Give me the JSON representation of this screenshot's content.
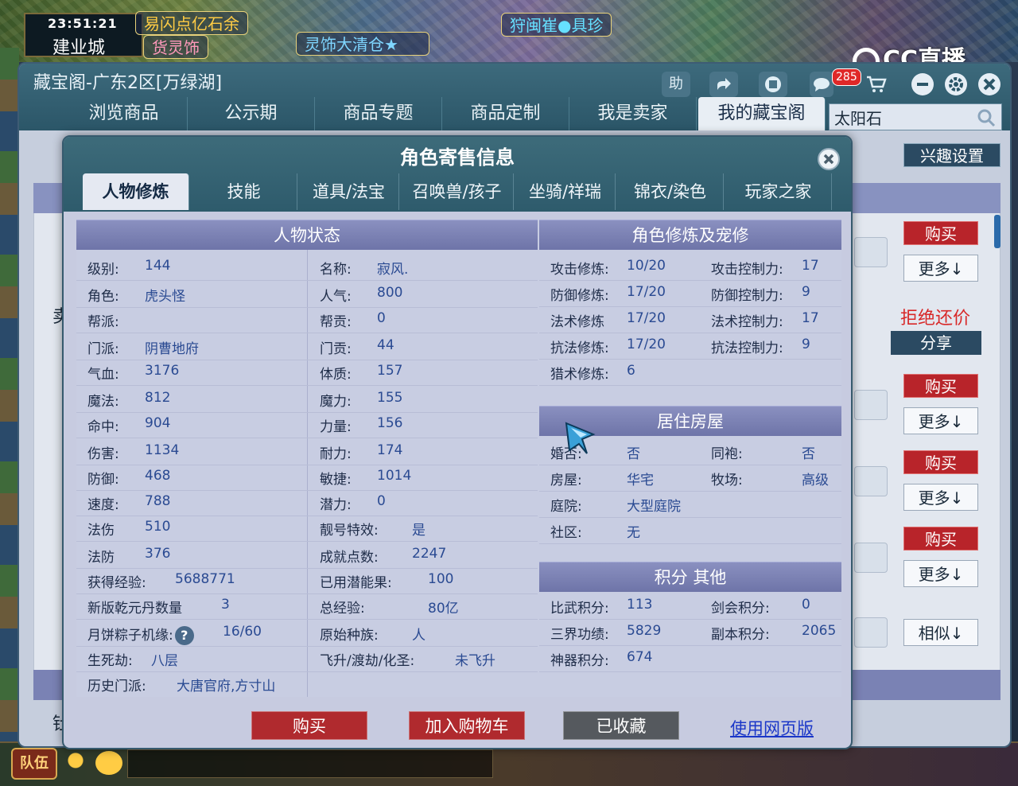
{
  "game": {
    "time": "23:51:21",
    "city": "建业城",
    "banners": [
      "易闪点亿石余",
      "货灵饰",
      "灵饰大清仓★",
      "狩闽崔●具珍"
    ],
    "stream_logo": "CC直播"
  },
  "window": {
    "title": "藏宝阁-广东2区[万绿湖]",
    "help_label": "助",
    "notif_count": "285",
    "nav_tabs": [
      "浏览商品",
      "公示期",
      "商品专题",
      "商品定制",
      "我是卖家",
      "我的藏宝阁"
    ],
    "search_value": "太阳石",
    "interest_label": "兴趣设置",
    "reject_text": "拒绝还价",
    "share_label": "分享",
    "side_buy": "购买",
    "side_more": "更多↓",
    "side_similar": "相似↓",
    "bg_label_1": "卖",
    "bg_label_2": "钍"
  },
  "dialog": {
    "title": "角色寄售信息",
    "tabs": [
      "人物修炼",
      "技能",
      "道具/法宝",
      "召唤兽/孩子",
      "坐骑/祥瑞",
      "锦衣/染色",
      "玩家之家"
    ],
    "status": {
      "header": "人物状态",
      "left": [
        {
          "label": "级别:",
          "value": "144"
        },
        {
          "label": "角色:",
          "value": "虎头怪"
        },
        {
          "label": "帮派:",
          "value": ""
        },
        {
          "label": "门派:",
          "value": "阴曹地府"
        },
        {
          "label": "气血:",
          "value": "3176"
        },
        {
          "label": "魔法:",
          "value": "812"
        },
        {
          "label": "命中:",
          "value": "904"
        },
        {
          "label": "伤害:",
          "value": "1134"
        },
        {
          "label": "防御:",
          "value": "468"
        },
        {
          "label": "速度:",
          "value": "788"
        },
        {
          "label": "法伤",
          "value": "510"
        },
        {
          "label": "法防",
          "value": "376"
        },
        {
          "label": "获得经验:",
          "value": "5688771"
        },
        {
          "label": "新版乾元丹数量",
          "value": "3"
        },
        {
          "label": "月饼粽子机缘:",
          "value": "16/60"
        },
        {
          "label": "生死劫:",
          "value": "八层"
        },
        {
          "label": "历史门派:",
          "value": "大唐官府,方寸山"
        }
      ],
      "mid": [
        {
          "label": "名称:",
          "value": "寂风."
        },
        {
          "label": "人气:",
          "value": "800"
        },
        {
          "label": "帮贡:",
          "value": "0"
        },
        {
          "label": "门贡:",
          "value": "44"
        },
        {
          "label": "体质:",
          "value": "157"
        },
        {
          "label": "魔力:",
          "value": "155"
        },
        {
          "label": "力量:",
          "value": "156"
        },
        {
          "label": "耐力:",
          "value": "174"
        },
        {
          "label": "敏捷:",
          "value": "1014"
        },
        {
          "label": "潜力:",
          "value": "0"
        },
        {
          "label": "靓号特效:",
          "value": "是"
        },
        {
          "label": "成就点数:",
          "value": "2247"
        },
        {
          "label": "已用潜能果:",
          "value": "100"
        },
        {
          "label": "总经验:",
          "value": "80亿"
        },
        {
          "label": "原始种族:",
          "value": "人"
        },
        {
          "label": "飞升/渡劫/化圣:",
          "value": "未飞升"
        }
      ]
    },
    "cultivation": {
      "header": "角色修炼及宠修",
      "rows": [
        {
          "l1": "攻击修炼:",
          "v1": "10/20",
          "l2": "攻击控制力:",
          "v2": "17"
        },
        {
          "l1": "防御修炼:",
          "v1": "17/20",
          "l2": "防御控制力:",
          "v2": "9"
        },
        {
          "l1": "法术修炼",
          "v1": "17/20",
          "l2": "法术控制力:",
          "v2": "17"
        },
        {
          "l1": "抗法修炼:",
          "v1": "17/20",
          "l2": "抗法控制力:",
          "v2": "9"
        },
        {
          "l1": "猎术修炼:",
          "v1": "6",
          "l2": "",
          "v2": ""
        }
      ]
    },
    "housing": {
      "header": "居住房屋",
      "rows": [
        {
          "l1": "婚否:",
          "v1": "否",
          "l2": "同袍:",
          "v2": "否"
        },
        {
          "l1": "房屋:",
          "v1": "华宅",
          "l2": "牧场:",
          "v2": "高级"
        },
        {
          "l1": "庭院:",
          "v1": "大型庭院",
          "l2": "",
          "v2": ""
        },
        {
          "l1": "社区:",
          "v1": "无",
          "l2": "",
          "v2": ""
        }
      ]
    },
    "points": {
      "header": "积分 其他",
      "rows": [
        {
          "l1": "比武积分:",
          "v1": "113",
          "l2": "剑会积分:",
          "v2": "0"
        },
        {
          "l1": "三界功绩:",
          "v1": "5829",
          "l2": "副本积分:",
          "v2": "2065"
        },
        {
          "l1": "神器积分:",
          "v1": "674",
          "l2": "",
          "v2": ""
        }
      ]
    },
    "footer": {
      "buy": "购买",
      "add_cart": "加入购物车",
      "favorited": "已收藏",
      "web_version": "使用网页版"
    }
  },
  "bottom": {
    "team_label": "队伍"
  },
  "colors": {
    "accent_teal": "#2e5b6c",
    "buy_red": "#b02a2e",
    "value_blue": "#2a4a92",
    "section_purple": "#6e74a8"
  }
}
